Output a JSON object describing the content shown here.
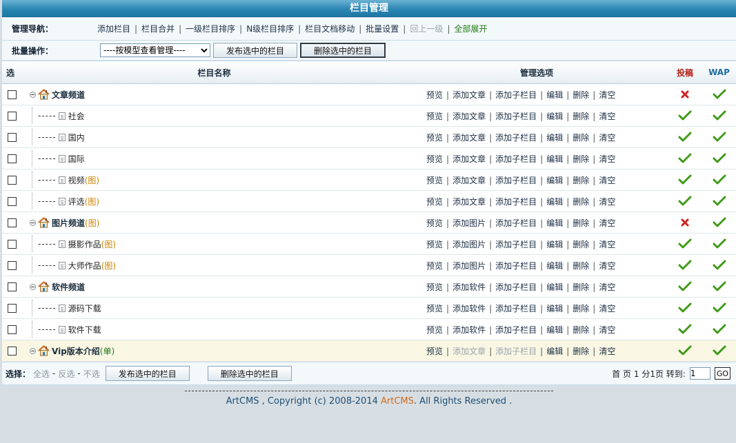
{
  "title": "栏目管理",
  "nav": {
    "label": "管理导航：",
    "links": [
      {
        "text": "添加栏目",
        "state": "normal"
      },
      {
        "text": "栏目合并",
        "state": "normal"
      },
      {
        "text": "一级栏目排序",
        "state": "normal"
      },
      {
        "text": "N级栏目排序",
        "state": "normal"
      },
      {
        "text": "栏目文档移动",
        "state": "normal"
      },
      {
        "text": "批量设置",
        "state": "normal"
      },
      {
        "text": "回上一级",
        "state": "disabled"
      },
      {
        "text": "全部展开",
        "state": "green"
      }
    ]
  },
  "batch": {
    "label": "批量操作：",
    "select_value": "----按模型查看管理----",
    "publish_label": "发布选中的栏目",
    "delete_label": "删除选中的栏目"
  },
  "table": {
    "headers": {
      "select": "选",
      "name": "栏目名称",
      "manage": "管理选项",
      "tougao": "投稿",
      "wap": "WAP"
    },
    "rows": [
      {
        "level": 1,
        "name": "文章频道",
        "tag": "",
        "actions": [
          "预览",
          "添加文章",
          "添加子栏目",
          "编辑",
          "删除",
          "清空"
        ],
        "disabled_actions": [],
        "tougao": false,
        "wap": true
      },
      {
        "level": 2,
        "name": "社会",
        "tag": "",
        "actions": [
          "预览",
          "添加文章",
          "添加子栏目",
          "编辑",
          "删除",
          "清空"
        ],
        "disabled_actions": [],
        "tougao": true,
        "wap": true
      },
      {
        "level": 2,
        "name": "国内",
        "tag": "",
        "actions": [
          "预览",
          "添加文章",
          "添加子栏目",
          "编辑",
          "删除",
          "清空"
        ],
        "disabled_actions": [],
        "tougao": true,
        "wap": true
      },
      {
        "level": 2,
        "name": "国际",
        "tag": "",
        "actions": [
          "预览",
          "添加文章",
          "添加子栏目",
          "编辑",
          "删除",
          "清空"
        ],
        "disabled_actions": [],
        "tougao": true,
        "wap": true
      },
      {
        "level": 2,
        "name": "视频",
        "tag": "(图)",
        "actions": [
          "预览",
          "添加文章",
          "添加子栏目",
          "编辑",
          "删除",
          "清空"
        ],
        "disabled_actions": [],
        "tougao": true,
        "wap": true
      },
      {
        "level": 2,
        "name": "评选",
        "tag": "(图)",
        "actions": [
          "预览",
          "添加文章",
          "添加子栏目",
          "编辑",
          "删除",
          "清空"
        ],
        "disabled_actions": [],
        "tougao": true,
        "wap": true
      },
      {
        "level": 1,
        "name": "图片频道",
        "tag": "(图)",
        "actions": [
          "预览",
          "添加图片",
          "添加子栏目",
          "编辑",
          "删除",
          "清空"
        ],
        "disabled_actions": [],
        "tougao": false,
        "wap": true
      },
      {
        "level": 2,
        "name": "摄影作品",
        "tag": "(图)",
        "actions": [
          "预览",
          "添加图片",
          "添加子栏目",
          "编辑",
          "删除",
          "清空"
        ],
        "disabled_actions": [],
        "tougao": true,
        "wap": true
      },
      {
        "level": 2,
        "name": "大师作品",
        "tag": "(图)",
        "actions": [
          "预览",
          "添加图片",
          "添加子栏目",
          "编辑",
          "删除",
          "清空"
        ],
        "disabled_actions": [],
        "tougao": true,
        "wap": true
      },
      {
        "level": 1,
        "name": "软件频道",
        "tag": "",
        "actions": [
          "预览",
          "添加软件",
          "添加子栏目",
          "编辑",
          "删除",
          "清空"
        ],
        "disabled_actions": [],
        "tougao": true,
        "wap": true
      },
      {
        "level": 2,
        "name": "源码下载",
        "tag": "",
        "actions": [
          "预览",
          "添加软件",
          "添加子栏目",
          "编辑",
          "删除",
          "清空"
        ],
        "disabled_actions": [],
        "tougao": true,
        "wap": true
      },
      {
        "level": 2,
        "name": "软件下载",
        "tag": "",
        "actions": [
          "预览",
          "添加软件",
          "添加子栏目",
          "编辑",
          "删除",
          "清空"
        ],
        "disabled_actions": [],
        "tougao": true,
        "wap": true
      },
      {
        "level": 1,
        "name": "Vip版本介绍",
        "tag": "(单)",
        "actions": [
          "预览",
          "添加文章",
          "添加子栏目",
          "编辑",
          "删除",
          "清空"
        ],
        "disabled_actions": [
          1,
          2
        ],
        "tougao": true,
        "wap": true,
        "highlight": true
      }
    ]
  },
  "footer": {
    "select_label": "选择：",
    "select_all": "全选",
    "select_invert": "反选",
    "select_none": "不选",
    "publish_label": "发布选中的栏目",
    "delete_label": "删除选中的栏目",
    "pager_text": "首 页 1 分1页 转到:",
    "page_value": "1",
    "go_label": "GO"
  },
  "copyright": {
    "prefix": "ArtCMS , Copyright (c) 2008-2014 ",
    "brand": "ArtCMS",
    "suffix": ". All Rights Reserved ."
  },
  "colors": {
    "check": "#3f9a17",
    "cross": "#d22020",
    "title_bar": "#2b86b2"
  }
}
